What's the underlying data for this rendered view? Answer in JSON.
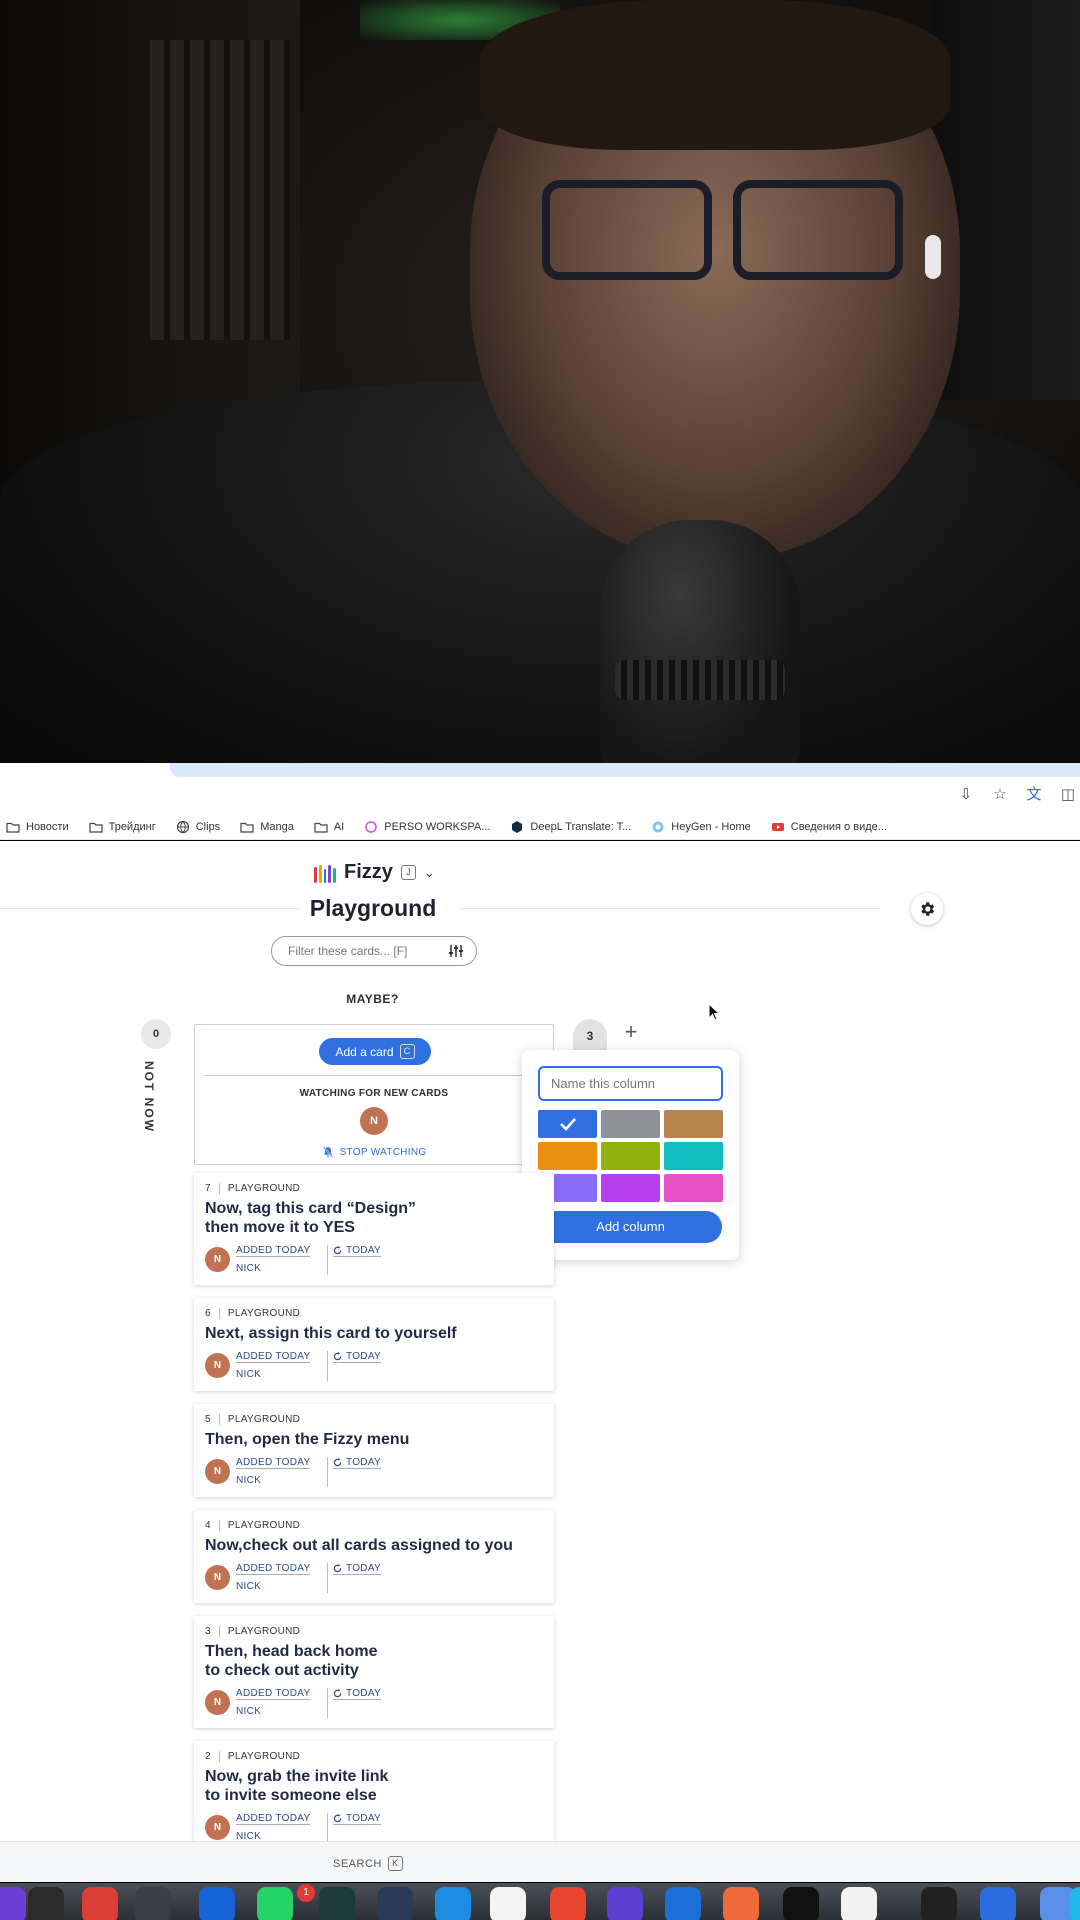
{
  "browser": {
    "bookmarks": [
      {
        "label": "Новости",
        "icon": "folder-icon"
      },
      {
        "label": "Трейдинг",
        "icon": "folder-icon"
      },
      {
        "label": "Clips",
        "icon": "globe-icon"
      },
      {
        "label": "Manga",
        "icon": "folder-icon"
      },
      {
        "label": "AI",
        "icon": "folder-icon"
      },
      {
        "label": "PERSO WORKSPA...",
        "icon": "perso-icon"
      },
      {
        "label": "DeepL Translate: T...",
        "icon": "deepl-icon"
      },
      {
        "label": "HeyGen - Home",
        "icon": "heygen-icon"
      },
      {
        "label": "Сведения о виде...",
        "icon": "youtube-icon"
      }
    ]
  },
  "app": {
    "brand": "Fizzy",
    "brand_shortcut": "J",
    "title": "Playground",
    "filter_placeholder": "Filter these cards... [F]",
    "column_heading": "MAYBE?",
    "notnow_count": "0",
    "notnow_label": "NOT NOW",
    "add_card_label": "Add a card",
    "add_card_shortcut": "C",
    "watching_title": "WATCHING FOR NEW CARDS",
    "watcher_initial": "N",
    "stop_watching": "STOP WATCHING",
    "col3_count": "3",
    "plus": "+",
    "search_label": "SEARCH",
    "search_shortcut": "K"
  },
  "popover": {
    "input_placeholder": "Name this column",
    "add_button": "Add column",
    "swatches": [
      "#2f6fe0",
      "#8e9196",
      "#b5864d",
      "#e8900c",
      "#93b10d",
      "#10bcbc",
      "#8b6cf6",
      "#b43ef0",
      "#e452c4"
    ],
    "selected_swatch": 0
  },
  "cards": [
    {
      "num": "7",
      "board": "PLAYGROUND",
      "title": "Now, tag this card “Design”\nthen move it to YES",
      "avatar": "N",
      "added": "ADDED TODAY",
      "author": "NICK",
      "updated": "TODAY"
    },
    {
      "num": "6",
      "board": "PLAYGROUND",
      "title": "Next, assign this card to yourself",
      "avatar": "N",
      "added": "ADDED TODAY",
      "author": "NICK",
      "updated": "TODAY"
    },
    {
      "num": "5",
      "board": "PLAYGROUND",
      "title": "Then, open the Fizzy menu",
      "avatar": "N",
      "added": "ADDED TODAY",
      "author": "NICK",
      "updated": "TODAY"
    },
    {
      "num": "4",
      "board": "PLAYGROUND",
      "title": "Now,check out all cards assigned to you",
      "avatar": "N",
      "added": "ADDED TODAY",
      "author": "NICK",
      "updated": "TODAY"
    },
    {
      "num": "3",
      "board": "PLAYGROUND",
      "title": "Then, head back home\nto check out activity",
      "avatar": "N",
      "added": "ADDED TODAY",
      "author": "NICK",
      "updated": "TODAY"
    },
    {
      "num": "2",
      "board": "PLAYGROUND",
      "title": "Now, grab the invite link\nto invite someone else",
      "avatar": "N",
      "added": "ADDED TODAY",
      "author": "NICK",
      "updated": "TODAY"
    }
  ],
  "dock": {
    "badge": "1",
    "icons": [
      "#6b3fd6",
      "#2b2b2b",
      "#db4035",
      "#3a3f47",
      "#1463d8",
      "#25d366",
      "#1e3a3a",
      "#2a3b5a",
      "#1d8ce0",
      "#f4f4f4",
      "#e8442e",
      "#5b3fd1",
      "#1b6fd6",
      "#ef6a3a",
      "#111111",
      "#f2f2f2",
      "#222",
      "#2d6cdf",
      "#5a8fe8",
      "#1fb8e8"
    ]
  }
}
